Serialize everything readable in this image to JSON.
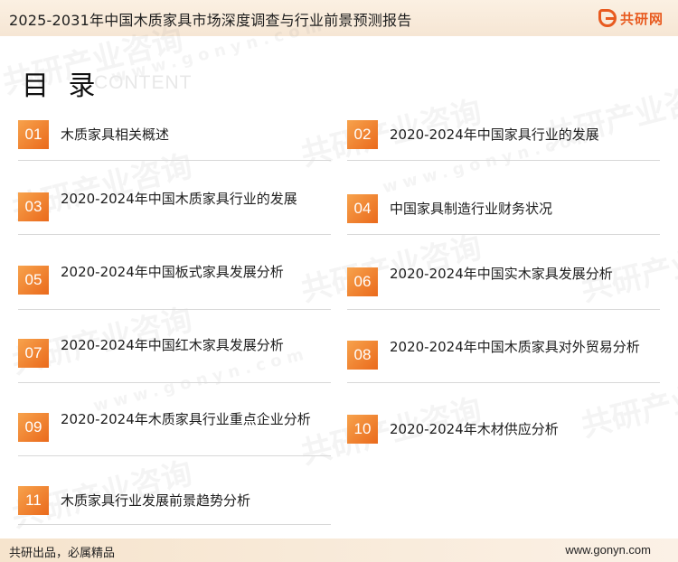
{
  "header": {
    "title": "2025-2031年中国木质家具市场深度调查与行业前景预测报告",
    "logo_text": "共研网"
  },
  "heading": {
    "main": "目 录",
    "sub": "CONTENT"
  },
  "watermark_text": "共研产业咨询",
  "watermark_url": "www.gonyn.com",
  "toc": [
    {
      "num": "01",
      "title": "木质家具相关概述"
    },
    {
      "num": "02",
      "title": "2020-2024年中国家具行业的发展"
    },
    {
      "num": "03",
      "title": "2020-2024年中国木质家具行业的发展"
    },
    {
      "num": "04",
      "title": "中国家具制造行业财务状况"
    },
    {
      "num": "05",
      "title": "2020-2024年中国板式家具发展分析"
    },
    {
      "num": "06",
      "title": "2020-2024年中国实木家具发展分析"
    },
    {
      "num": "07",
      "title": "2020-2024年中国红木家具发展分析"
    },
    {
      "num": "08",
      "title": "2020-2024年中国木质家具对外贸易分析"
    },
    {
      "num": "09",
      "title": "2020-2024年木质家具行业重点企业分析"
    },
    {
      "num": "10",
      "title": "2020-2024年木材供应分析"
    },
    {
      "num": "11",
      "title": "木质家具行业发展前景趋势分析"
    }
  ],
  "footer": {
    "left": "共研出品，必属精品",
    "right": "www.gonyn.com"
  },
  "colors": {
    "accent": "#ea6a1c",
    "accent_light": "#f7a24c"
  }
}
